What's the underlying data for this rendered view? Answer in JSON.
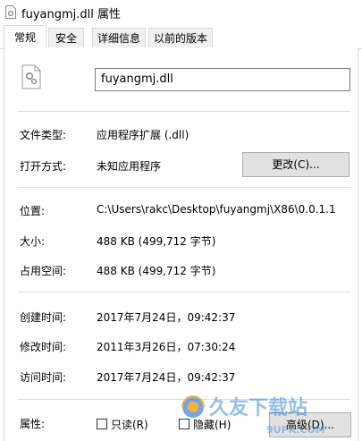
{
  "window": {
    "title": "fuyangmj.dll 属性"
  },
  "tabs": [
    {
      "label": "常规",
      "active": true
    },
    {
      "label": "安全",
      "active": false
    },
    {
      "label": "详细信息",
      "active": false
    },
    {
      "label": "以前的版本",
      "active": false
    }
  ],
  "general": {
    "file_name": "fuyangmj.dll",
    "type_label": "文件类型:",
    "type_value": "应用程序扩展 (.dll)",
    "opens_label": "打开方式:",
    "opens_value": "未知应用程序",
    "change_button": "更改(C)...",
    "location_label": "位置:",
    "location_value": "C:\\Users\\rakc\\Desktop\\fuyangmj\\X86\\0.0.1.1",
    "size_label": "大小:",
    "size_value": "488 KB (499,712 字节)",
    "disk_label": "占用空间:",
    "disk_value": "488 KB (499,712 字节)",
    "created_label": "创建时间:",
    "created_value": "2017年7月24日，09:42:37",
    "modified_label": "修改时间:",
    "modified_value": "2011年3月26日，07:30:24",
    "accessed_label": "访问时间:",
    "accessed_value": "2017年7月24日，09:42:37",
    "attributes_label": "属性:",
    "readonly_label": "只读(R)",
    "hidden_label": "隐藏(H)",
    "advanced_button": "高级(D)..."
  },
  "watermark": {
    "text": "久友下载站",
    "url": "9UPK.COM"
  },
  "icons": {
    "title": "document-gear-icon",
    "file": "dll-gear-icon"
  },
  "colors": {
    "tab_inactive": "#f0f0f0",
    "border": "#d9d9d9",
    "button": "#e1e1e1",
    "watermark_blue": "#2f7fd1",
    "watermark_orange": "#f5a623"
  }
}
